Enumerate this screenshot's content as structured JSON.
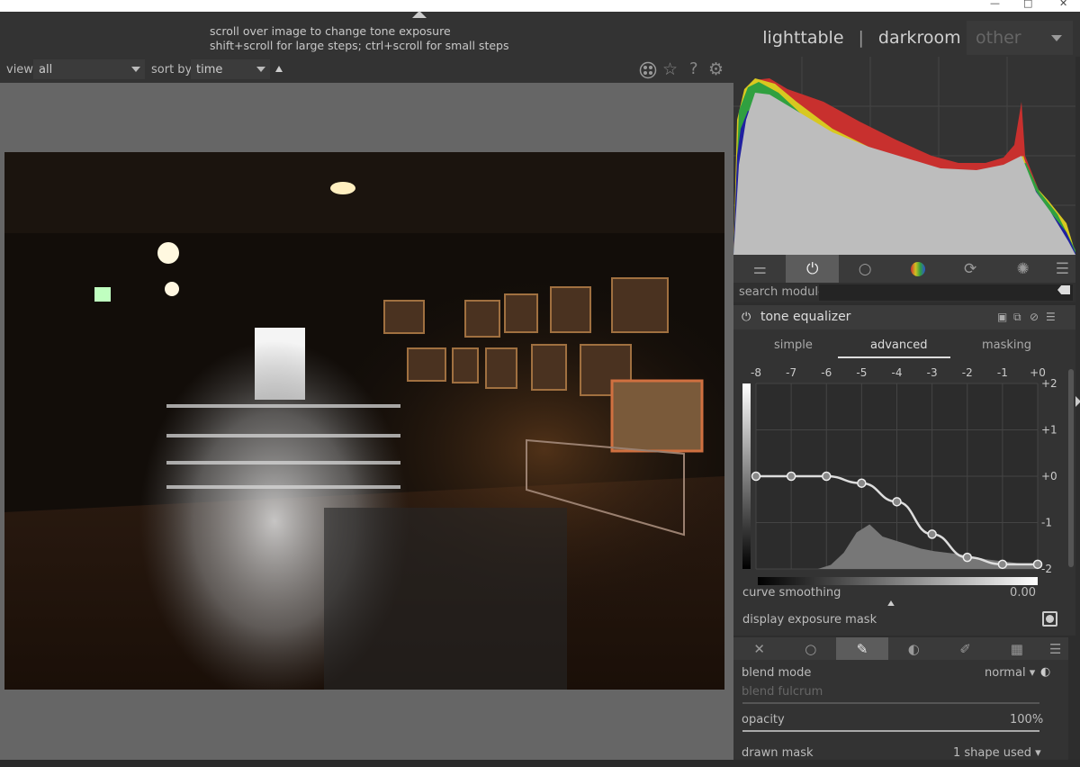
{
  "window": {
    "restore_icon": "□",
    "close_icon": "✕"
  },
  "header": {
    "hint_line1": "scroll over image to change tone exposure",
    "hint_line2": "shift+scroll for large steps; ctrl+scroll for small steps",
    "views": {
      "lighttable": "lighttable",
      "separator": "|",
      "darkroom": "darkroom",
      "other": "other"
    }
  },
  "filterbar": {
    "view_label": "view",
    "view_value": "all",
    "sort_label": "sort by",
    "sort_value": "time",
    "icons": [
      "color-labels-icon",
      "star-icon",
      "help-icon",
      "gear-icon"
    ]
  },
  "rightpanel": {
    "module_tabs": [
      {
        "name": "quick-access-icon",
        "glyph": "⚌"
      },
      {
        "name": "active-modules-icon",
        "glyph": "⏻"
      },
      {
        "name": "base-modules-icon",
        "glyph": "○"
      },
      {
        "name": "color-modules-icon",
        "glyph": "●"
      },
      {
        "name": "correct-modules-icon",
        "glyph": "⟳"
      },
      {
        "name": "effect-modules-icon",
        "glyph": "✺"
      },
      {
        "name": "menu-icon",
        "glyph": "☰"
      }
    ],
    "search_label": "search module",
    "module": {
      "name": "tone equalizer",
      "subtabs": [
        "simple",
        "advanced",
        "masking"
      ],
      "active_subtab": "advanced",
      "ev_labels": [
        "-8",
        "-7",
        "-6",
        "-5",
        "-4",
        "-3",
        "-2",
        "-1",
        "+0"
      ],
      "y_labels": [
        "+2",
        "+1",
        "+0",
        "-1",
        "-2"
      ],
      "curve_nodes_ev": [
        0,
        0,
        0,
        -0.15,
        -0.55,
        -1.25,
        -1.75,
        -1.9,
        -1.9
      ],
      "curve_smoothing_label": "curve smoothing",
      "curve_smoothing_value": "0.00",
      "display_exposure_mask_label": "display exposure mask"
    },
    "mask_tabs": [
      {
        "name": "mask-off-icon",
        "glyph": "✕"
      },
      {
        "name": "uniform-mask-icon",
        "glyph": "○"
      },
      {
        "name": "drawn-mask-icon",
        "glyph": "✎"
      },
      {
        "name": "parametric-mask-icon",
        "glyph": "◐"
      },
      {
        "name": "drawn-parametric-mask-icon",
        "glyph": "✐"
      },
      {
        "name": "raster-mask-icon",
        "glyph": "▦"
      },
      {
        "name": "mask-menu-icon",
        "glyph": "☰"
      }
    ],
    "active_mask_tab": 2,
    "blend": {
      "mode_label": "blend mode",
      "mode_value": "normal",
      "fulcrum_label": "blend fulcrum",
      "opacity_label": "opacity",
      "opacity_value": "100%",
      "drawn_mask_label": "drawn mask",
      "drawn_mask_value": "1 shape used"
    }
  }
}
